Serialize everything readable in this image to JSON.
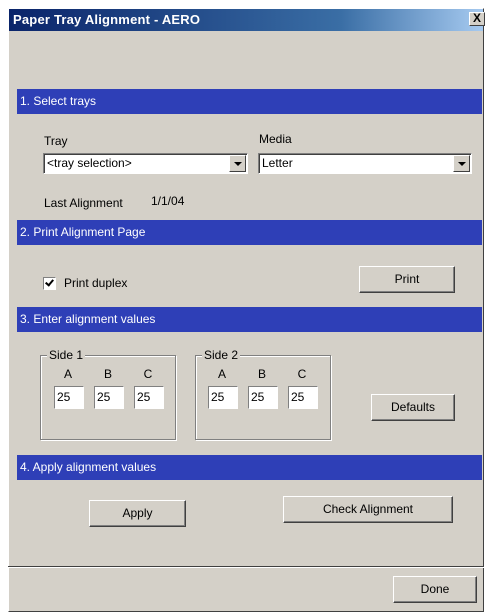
{
  "window": {
    "title": "Paper Tray Alignment - AERO",
    "close_glyph": "X"
  },
  "sections": {
    "select": "1. Select trays",
    "print": "2. Print Alignment Page",
    "enter": "3. Enter alignment values",
    "apply": "4. Apply alignment values"
  },
  "trays": {
    "tray_label": "Tray",
    "tray_value": "<tray selection>",
    "media_label": "Media",
    "media_value": "Letter",
    "last_alignment_label": "Last Alignment",
    "last_alignment_value": "1/1/04"
  },
  "print": {
    "duplex_label": "Print duplex",
    "duplex_checked": true,
    "print_button": "Print"
  },
  "side1": {
    "title": "Side 1",
    "headers": [
      "A",
      "B",
      "C"
    ],
    "values": [
      "25",
      "25",
      "25"
    ]
  },
  "side2": {
    "title": "Side 2",
    "headers": [
      "A",
      "B",
      "C"
    ],
    "values": [
      "25",
      "25",
      "25"
    ]
  },
  "defaults_button": "Defaults",
  "apply_button": "Apply",
  "check_alignment_button": "Check Alignment",
  "done_button": "Done",
  "colors": {
    "title_bar": "#0a246a",
    "section_bar": "#2e3fb7",
    "dialog_face": "#d4d0c8"
  }
}
